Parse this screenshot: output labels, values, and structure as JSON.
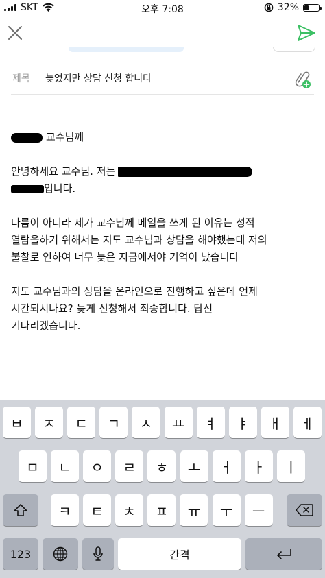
{
  "status_bar": {
    "carrier": "SKT",
    "time": "오후 7:08",
    "battery_percent": "32%",
    "battery_level": 0.32
  },
  "compose": {
    "close_icon": "close-icon",
    "send_icon": "send-icon",
    "subject_label": "제목",
    "subject_value": "늦었지만 상담 신청 합니다",
    "attach_icon": "paperclip-add-icon",
    "accent_color": "#3cc064"
  },
  "body": {
    "greeting_suffix": "교수님께",
    "intro_1": "안녕하세요 교수님. 저는",
    "intro_2": "입니다.",
    "para_1_line_1": "다름이 아니라 제가 교수님께 메일을 쓰게 된 이유는 성적",
    "para_1_line_2": "열람을하기 위해서는 지도 교수님과 상담을 해야했는데 저의",
    "para_1_line_3": "불찰로 인하여 너무 늦은 지금에서야 기억이 났습니다",
    "para_2_line_1": "지도 교수님과의 상담을 온라인으로 진행하고 싶은데 언제",
    "para_2_line_2": "시간되시나요? 늦게 신청해서 죄송합니다. 답신",
    "para_2_line_3": "기다리겠습니다."
  },
  "keyboard": {
    "row1": [
      "ㅂ",
      "ㅈ",
      "ㄷ",
      "ㄱ",
      "ㅅ",
      "ㅛ",
      "ㅕ",
      "ㅑ",
      "ㅐ",
      "ㅔ"
    ],
    "row2": [
      "ㅁ",
      "ㄴ",
      "ㅇ",
      "ㄹ",
      "ㅎ",
      "ㅗ",
      "ㅓ",
      "ㅏ",
      "ㅣ"
    ],
    "row3": [
      "ㅋ",
      "ㅌ",
      "ㅊ",
      "ㅍ",
      "ㅠ",
      "ㅜ",
      "ㅡ"
    ],
    "shift_icon": "shift-icon",
    "backspace_icon": "backspace-icon",
    "numbers_label": "123",
    "globe_icon": "globe-icon",
    "mic_icon": "microphone-icon",
    "space_label": "간격",
    "return_icon": "return-icon"
  }
}
